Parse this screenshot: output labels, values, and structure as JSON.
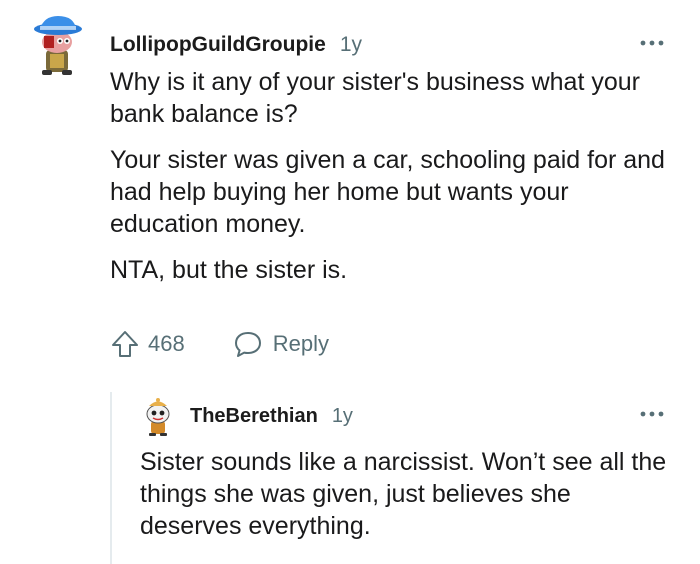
{
  "comment": {
    "username": "LollipopGuildGroupie",
    "age": "1y",
    "avatar_icon": "snoo-avatar-blue-hat-icon",
    "more_icon": "ellipsis-icon",
    "paragraphs": [
      "Why is it any of your sister's business what your bank balance is?",
      "Your sister was given a car, schooling paid for and had help buying her home but wants your education money.",
      "NTA, but the sister is."
    ],
    "actions": {
      "upvote_icon": "upvote-arrow-icon",
      "vote_count": "468",
      "reply_icon": "speech-bubble-icon",
      "reply_label": "Reply"
    }
  },
  "reply": {
    "username": "TheBerethian",
    "age": "1y",
    "avatar_icon": "snoo-avatar-orange-icon",
    "more_icon": "ellipsis-icon",
    "paragraphs": [
      "Sister sounds like a narcissist. Won’t see all the things she was given, just believes she deserves everything."
    ]
  },
  "colors": {
    "text": "#1a1a1b",
    "meta": "#576f76",
    "thread_line": "#e5ebee"
  }
}
